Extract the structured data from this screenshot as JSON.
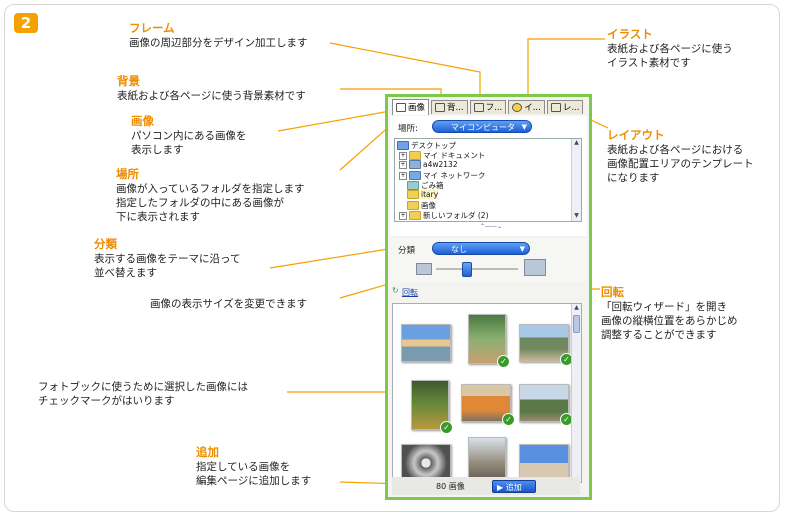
{
  "step_number": "2",
  "annotations": {
    "frame": {
      "title": "フレーム",
      "desc": [
        "画像の周辺部分をデザイン加工します"
      ]
    },
    "background": {
      "title": "背景",
      "desc": [
        "表紙および各ページに使う背景素材です"
      ]
    },
    "image": {
      "title": "画像",
      "desc": [
        "パソコン内にある画像を",
        "表示します"
      ]
    },
    "location": {
      "title": "場所",
      "desc": [
        "画像が入っているフォルダを指定します",
        "指定したフォルダの中にある画像が",
        "下に表示されます"
      ]
    },
    "category": {
      "title": "分類",
      "desc": [
        "表示する画像をテーマに沿って",
        "並べ替えます"
      ]
    },
    "size": {
      "desc": [
        "画像の表示サイズを変更できます"
      ]
    },
    "photobook": {
      "desc": [
        "フォトブックに使うために選択した画像には",
        "チェックマークがはいります"
      ]
    },
    "add": {
      "title": "追加",
      "desc": [
        "指定している画像を",
        "編集ページに追加します"
      ]
    },
    "illust": {
      "title": "イラスト",
      "desc": [
        "表紙および各ページに使う",
        "イラスト素材です"
      ]
    },
    "layout": {
      "title": "レイアウト",
      "desc": [
        "表紙および各ページにおける",
        "画像配置エリアのテンプレート",
        "になります"
      ]
    },
    "rotate": {
      "title": "回転",
      "desc": [
        "「回転ウィザード」を開き",
        "画像の縦横位置をあらかじめ",
        "調整することができます"
      ]
    }
  },
  "app": {
    "tabs": [
      "画像",
      "背...",
      "フ...",
      "イ...",
      "レ..."
    ],
    "location_label": "場所:",
    "location_value": "マイコンピュータ",
    "tree": [
      {
        "label": "デスクトップ",
        "level": 0
      },
      {
        "label": "マイ ドキュメント",
        "level": 1
      },
      {
        "label": "a4w2132",
        "level": 1
      },
      {
        "label": "マイ ネットワーク",
        "level": 1
      },
      {
        "label": "ごみ箱",
        "level": 1
      },
      {
        "label": "itary",
        "level": 1
      },
      {
        "label": "画像",
        "level": 1
      },
      {
        "label": "新しいフォルダ (2)",
        "level": 1
      }
    ],
    "category_label": "分類",
    "category_value": "なし",
    "rotate_link": "回転",
    "image_count": "80 画像",
    "add_button": "追加"
  },
  "colors": {
    "accent": "#f08c00",
    "window_border": "#7ec84c",
    "combo_blue": "#1f5fd6",
    "check": "#3a9a2a"
  }
}
